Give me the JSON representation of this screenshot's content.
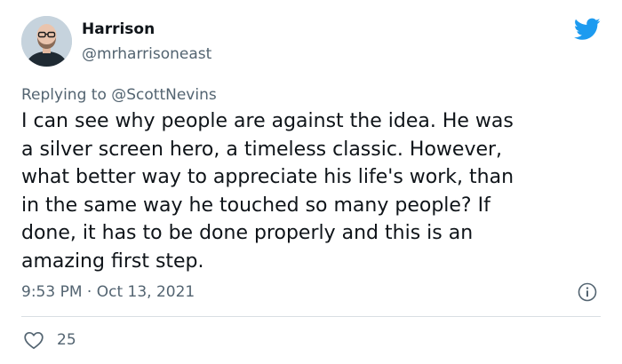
{
  "author": {
    "name": "Harrison",
    "handle": "@mrharrisoneast"
  },
  "reply": {
    "prefix": "Replying to ",
    "mention": "@ScottNevins"
  },
  "tweet": {
    "lines": [
      "I can see why people are against the idea. He was",
      "a silver screen hero, a timeless classic. However,",
      "what better way to appreciate his life's work, than",
      "in the same way he touched so many people? If",
      "done, it has to be done properly and this is an",
      "amazing first step."
    ]
  },
  "meta": {
    "time": "9:53 PM",
    "separator": " · ",
    "date": "Oct 13, 2021"
  },
  "actions": {
    "likes": "25"
  },
  "colors": {
    "twitter_blue": "#1d9bf0",
    "secondary_text": "#536471",
    "divider": "#d9dfe3"
  },
  "icons": {
    "brand": "twitter-bird-icon",
    "info": "info-icon",
    "like": "heart-icon"
  }
}
